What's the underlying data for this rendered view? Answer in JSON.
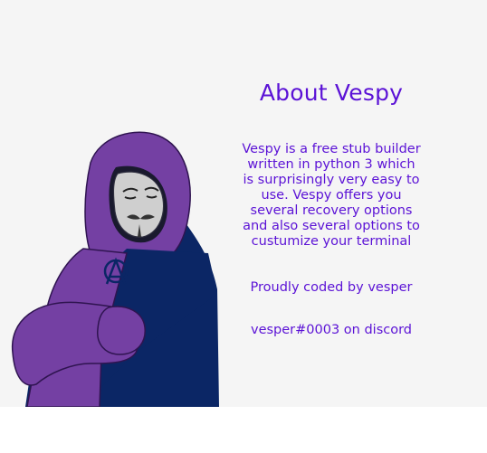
{
  "about": {
    "title": "About Vespy",
    "description": "Vespy is a free stub builder written in python 3 which is surprisingly very easy to use. Vespy offers you several recovery options and also several options to custumize your terminal",
    "credit": "Proudly coded by vesper",
    "contact": "vesper#0003 on discord"
  },
  "illustration": {
    "subject": "hooded-figure-with-mask",
    "colors": {
      "hoodie": "#7440a3",
      "sash": "#0b2665",
      "mask": "#cfcfcf",
      "text": "#5b12d6",
      "background": "#f5f5f5"
    }
  }
}
